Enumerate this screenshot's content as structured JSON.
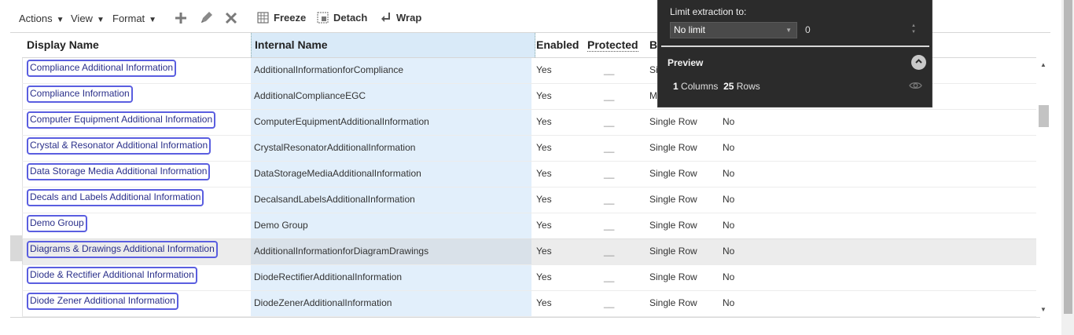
{
  "toolbar": {
    "actions": "Actions",
    "view": "View",
    "format": "Format",
    "freeze": "Freeze",
    "detach": "Detach",
    "wrap": "Wrap"
  },
  "columns": {
    "display_name": "Display Name",
    "internal_name": "Internal Name",
    "enabled": "Enabled",
    "protected": "Protected",
    "b_partial": "B"
  },
  "rows": [
    {
      "display": "Compliance Additional Information",
      "internal": "AdditionalInformationforCompliance",
      "enabled": "Yes",
      "protected": "__",
      "b": "Si",
      "f": ""
    },
    {
      "display": "Compliance Information",
      "internal": "AdditionalComplianceEGC",
      "enabled": "Yes",
      "protected": "__",
      "b": "M",
      "f": ""
    },
    {
      "display": "Computer Equipment Additional Information",
      "internal": "ComputerEquipmentAdditionalInformation",
      "enabled": "Yes",
      "protected": "__",
      "b": "Single Row",
      "f": "No"
    },
    {
      "display": "Crystal & Resonator Additional Information",
      "internal": "CrystalResonatorAdditionalInformation",
      "enabled": "Yes",
      "protected": "__",
      "b": "Single Row",
      "f": "No"
    },
    {
      "display": "Data Storage Media Additional Information",
      "internal": "DataStorageMediaAdditionalInformation",
      "enabled": "Yes",
      "protected": "__",
      "b": "Single Row",
      "f": "No"
    },
    {
      "display": "Decals and Labels Additional Information",
      "internal": "DecalsandLabelsAdditionalInformation",
      "enabled": "Yes",
      "protected": "__",
      "b": "Single Row",
      "f": "No"
    },
    {
      "display": "Demo Group",
      "internal": "Demo Group",
      "enabled": "Yes",
      "protected": "__",
      "b": "Single Row",
      "f": "No"
    },
    {
      "display": "Diagrams & Drawings Additional Information",
      "internal": "AdditionalInformationforDiagramDrawings",
      "enabled": "Yes",
      "protected": "__",
      "b": "Single Row",
      "f": "No"
    },
    {
      "display": "Diode & Rectifier Additional Information",
      "internal": "DiodeRectifierAdditionalInformation",
      "enabled": "Yes",
      "protected": "__",
      "b": "Single Row",
      "f": "No"
    },
    {
      "display": "Diode Zener Additional Information",
      "internal": "DiodeZenerAdditionalInformation",
      "enabled": "Yes",
      "protected": "__",
      "b": "Single Row",
      "f": "No"
    }
  ],
  "selected_row_index": 7,
  "panel": {
    "limit_label": "Limit extraction to:",
    "limit_value": "No limit",
    "limit_number": "0",
    "preview_title": "Preview",
    "columns_count": "1",
    "columns_label": "Columns",
    "rows_count": "25",
    "rows_label": "Rows"
  },
  "colors": {
    "link_outline": "#5a5ee0",
    "internal_column_bg": "#e2effb",
    "panel_bg": "#2b2b2b"
  }
}
